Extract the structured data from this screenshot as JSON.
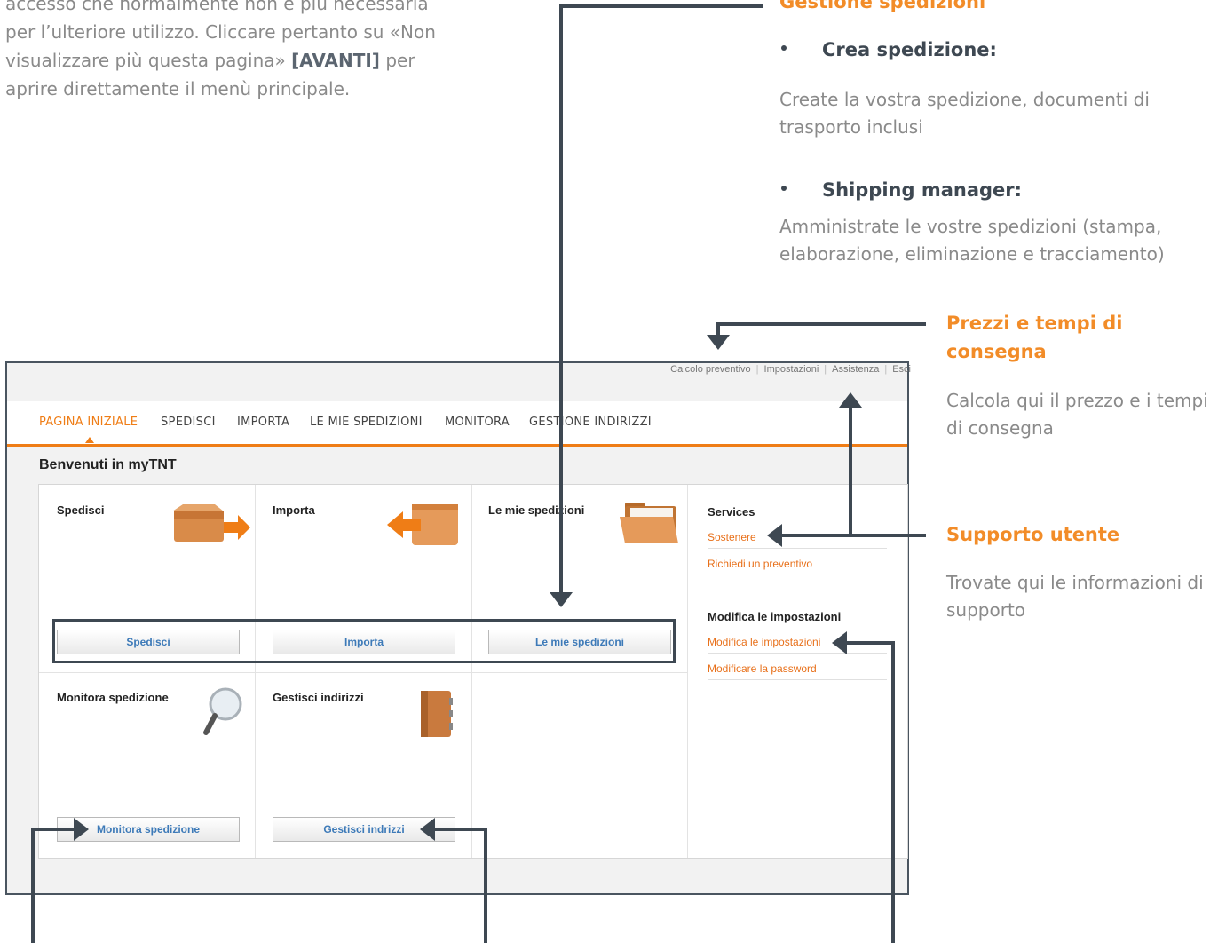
{
  "intro": {
    "line1": "accesso che normalmente non è più necessaria",
    "line2": "per l’ulteriore utilizzo. Cliccare pertanto su «Non",
    "line3": "visualizzare più questa pagina»",
    "line3_bold": "[AVANTI]",
    "line3_end": "per",
    "line4": "aprire direttamente il menù principale."
  },
  "notes": {
    "gestione": {
      "heading": "Gestione spedizioni",
      "bullet1": "Crea spedizione:",
      "text1": "Create la vostra spedizione, documenti di trasporto inclusi",
      "bullet2": "Shipping manager:",
      "text2": "Amministrate le vostre spedizioni (stampa, elaborazione, eliminazione e tracciamento)"
    },
    "prezzi": {
      "heading": "Prezzi e tempi di consegna",
      "text": "Calcola qui il prezzo e i tempi di consegna"
    },
    "supporto": {
      "heading": "Supporto utente",
      "text": "Trovate qui le informazioni di supporto"
    }
  },
  "toplinks": [
    "Calcolo preventivo",
    "Impostazioni",
    "Assistenza",
    "Esci"
  ],
  "nav": {
    "items": [
      "PAGINA INIZIALE",
      "SPEDISCI",
      "IMPORTA",
      "LE MIE SPEDIZIONI",
      "MONITORA",
      "GESTIONE INDIRIZZI"
    ],
    "active": "PAGINA INIZIALE"
  },
  "welcome": "Benvenuti in myTNT",
  "cells": [
    {
      "title": "Spedisci",
      "button": "Spedisci",
      "icon": "box-arrow-icon"
    },
    {
      "title": "Importa",
      "button": "Importa",
      "icon": "import-box-icon"
    },
    {
      "title": "Le mie spedizioni",
      "button": "Le mie spedizioni",
      "icon": "folder-icon"
    },
    {
      "title": "Monitora spedizione",
      "button": "Monitora spedizione",
      "icon": "magnifier-icon"
    },
    {
      "title": "Gestisci indirizzi",
      "button": "Gestisci indrizzi",
      "icon": "address-book-icon"
    }
  ],
  "sidebar": {
    "services": {
      "heading": "Services",
      "links": [
        "Sostenere",
        "Richiedi un preventivo"
      ]
    },
    "settings": {
      "heading": "Modifica le impostazioni",
      "links": [
        "Modifica le impostazioni",
        "Modificare la password"
      ]
    }
  },
  "colors": {
    "accent": "#ef7d16",
    "link": "#3d7ab8",
    "annotation": "#3e4852",
    "heading_note": "#f28c28"
  }
}
